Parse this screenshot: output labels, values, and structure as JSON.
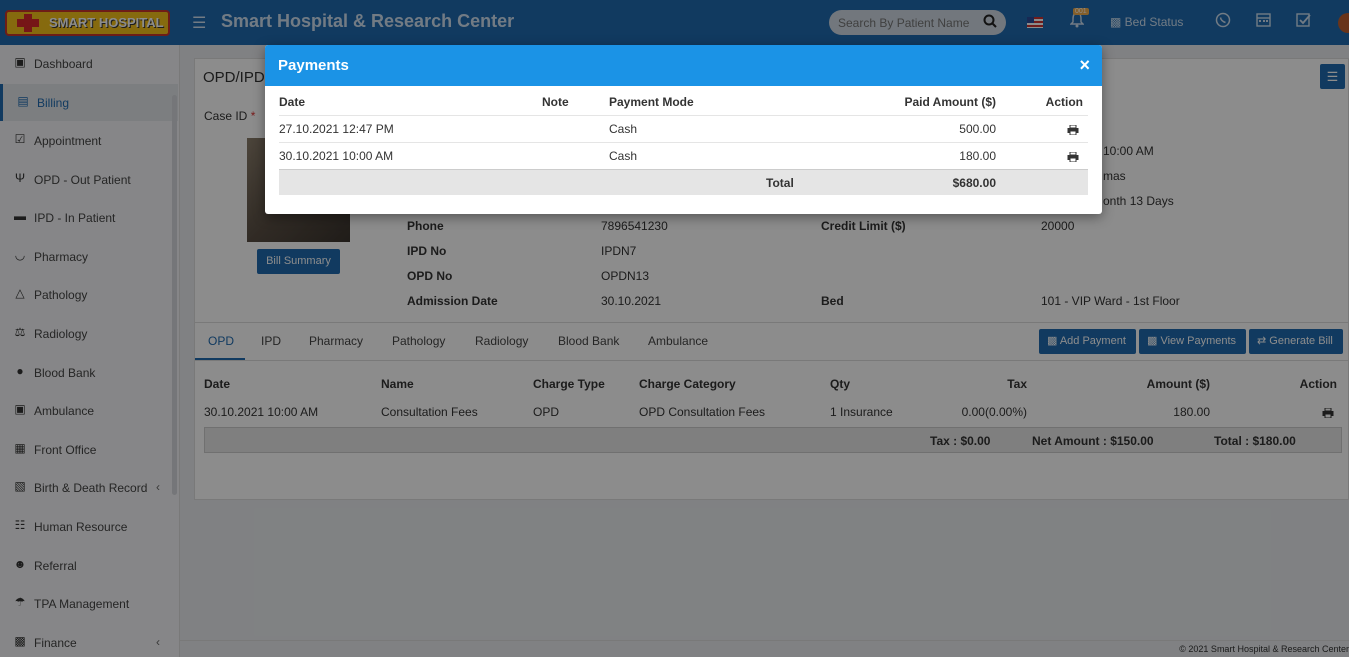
{
  "header": {
    "logo_text": "SMART HOSPITAL",
    "app_title": "Smart Hospital & Research Center",
    "search_placeholder": "Search By Patient Name",
    "notif_badge": "001",
    "bed_status": "Bed Status"
  },
  "sidebar": {
    "items": [
      {
        "label": "Dashboard",
        "icon": "monitor-icon",
        "active": false
      },
      {
        "label": "Billing",
        "icon": "file-icon",
        "active": true
      },
      {
        "label": "Appointment",
        "icon": "calendar-check-icon",
        "active": false
      },
      {
        "label": "OPD - Out Patient",
        "icon": "stethoscope-icon",
        "active": false
      },
      {
        "label": "IPD - In Patient",
        "icon": "bed-icon",
        "active": false
      },
      {
        "label": "Pharmacy",
        "icon": "mortar-icon",
        "active": false
      },
      {
        "label": "Pathology",
        "icon": "flask-icon",
        "active": false
      },
      {
        "label": "Radiology",
        "icon": "microscope-icon",
        "active": false
      },
      {
        "label": "Blood Bank",
        "icon": "tint-icon",
        "active": false
      },
      {
        "label": "Ambulance",
        "icon": "ambulance-icon",
        "active": false
      },
      {
        "label": "Front Office",
        "icon": "building-icon",
        "active": false
      },
      {
        "label": "Birth & Death Record",
        "icon": "family-icon",
        "active": false
      },
      {
        "label": "Human Resource",
        "icon": "sitemap-icon",
        "active": false
      },
      {
        "label": "Referral",
        "icon": "users-icon",
        "active": false
      },
      {
        "label": "TPA Management",
        "icon": "umbrella-icon",
        "active": false
      },
      {
        "label": "Finance",
        "icon": "money-icon",
        "active": false
      }
    ]
  },
  "page": {
    "title": "OPD/IPD",
    "case_id_label": "Case ID",
    "case_id_required": "*",
    "bill_summary": "Bill Summary",
    "info_partial": [
      "10:00 AM",
      "mas",
      "onth 13 Days"
    ],
    "details": [
      {
        "label": "Phone",
        "value": "7896541230",
        "label2": "Credit Limit ($)",
        "value2": "20000"
      },
      {
        "label": "IPD No",
        "value": "IPDN7",
        "label2": "",
        "value2": ""
      },
      {
        "label": "OPD No",
        "value": "OPDN13",
        "label2": "",
        "value2": ""
      },
      {
        "label": "Admission Date",
        "value": "30.10.2021",
        "label2": "Bed",
        "value2": "101 - VIP Ward - 1st Floor"
      }
    ],
    "tabs": [
      "OPD",
      "IPD",
      "Pharmacy",
      "Pathology",
      "Radiology",
      "Blood Bank",
      "Ambulance"
    ],
    "buttons": {
      "add_payment": "Add Payment",
      "view_payments": "View Payments",
      "generate_bill": "Generate Bill"
    },
    "charges": {
      "headers": [
        "Date",
        "Name",
        "Charge Type",
        "Charge Category",
        "Qty",
        "Tax",
        "Amount ($)",
        "Action"
      ],
      "rows": [
        {
          "date": "30.10.2021 10:00 AM",
          "name": "Consultation Fees",
          "charge_type": "OPD",
          "charge_category": "OPD Consultation Fees",
          "qty": "1 Insurance",
          "tax": "0.00(0.00%)",
          "amount": "180.00"
        }
      ],
      "totals": {
        "tax": "Tax : $0.00",
        "net": "Net Amount : $150.00",
        "total": "Total : $180.00"
      }
    },
    "footer": "© 2021 Smart Hospital & Research Center"
  },
  "modal": {
    "title": "Payments",
    "close": "×",
    "headers": {
      "date": "Date",
      "note": "Note",
      "mode": "Payment Mode",
      "paid": "Paid Amount ($)",
      "action": "Action"
    },
    "rows": [
      {
        "date": "27.10.2021 12:47 PM",
        "note": "",
        "mode": "Cash",
        "paid": "500.00"
      },
      {
        "date": "30.10.2021 10:00 AM",
        "note": "",
        "mode": "Cash",
        "paid": "180.00"
      }
    ],
    "total_label": "Total",
    "total_value": "$680.00"
  }
}
